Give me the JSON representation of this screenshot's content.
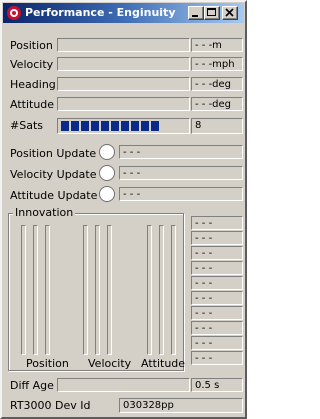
{
  "window": {
    "title": "Performance - Enginuity"
  },
  "rows": [
    {
      "label": "Position",
      "unit": "- - -m"
    },
    {
      "label": "Velocity",
      "unit": "- - -mph"
    },
    {
      "label": "Heading",
      "unit": "- - -deg"
    },
    {
      "label": "Attitude",
      "unit": "- - -deg"
    }
  ],
  "sats": {
    "label": "#Sats",
    "value": "8",
    "segments": 10
  },
  "updates": [
    {
      "label": "Position Update",
      "value": "- - -"
    },
    {
      "label": "Velocity Update",
      "value": "- - -"
    },
    {
      "label": "Attitude Update",
      "value": "- - -"
    }
  ],
  "innovation": {
    "title": "Innovation",
    "columns": [
      "Position",
      "Velocity",
      "Attitude"
    ],
    "side_values": [
      "- - -",
      "- - -",
      "- - -",
      "- - -",
      "- - -",
      "- - -",
      "- - -",
      "- - -",
      "- - -",
      "- - -"
    ]
  },
  "diff_age": {
    "label": "Diff Age",
    "value": "0.5 s"
  },
  "device": {
    "label": "RT3000 Dev Id",
    "value": "030328pp"
  },
  "colors": {
    "titlebar_start": "#0a246a",
    "sat_bar": "#0a2a8a",
    "face": "#d4d0c8"
  }
}
